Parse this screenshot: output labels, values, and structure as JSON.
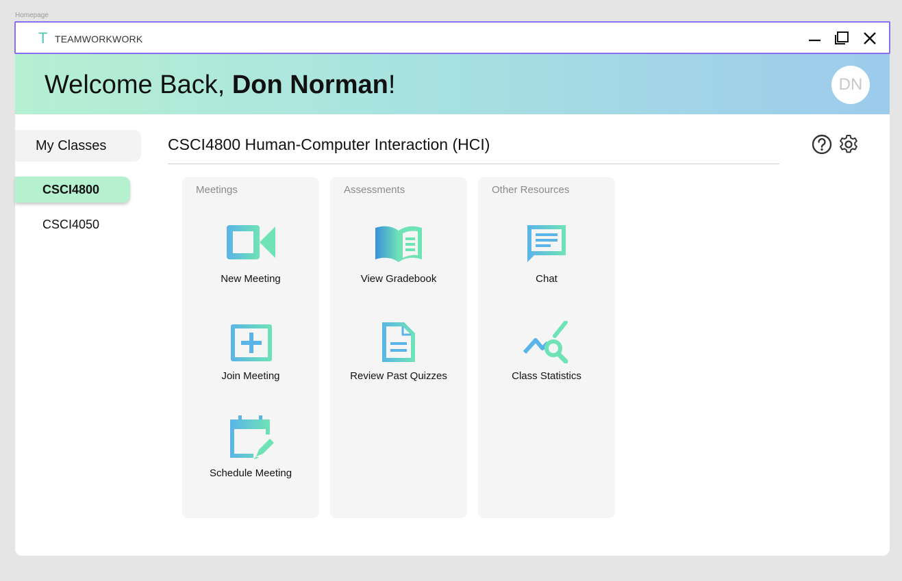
{
  "frame_label": "Homepage",
  "titlebar": {
    "logo_letter": "T",
    "app_name": "TEAMWORKWORK"
  },
  "header": {
    "welcome_prefix": "Welcome Back, ",
    "user_name": "Don Norman",
    "welcome_suffix": "!",
    "avatar_initials": "DN"
  },
  "sidebar": {
    "heading": "My Classes",
    "classes": [
      {
        "label": "CSCI4800",
        "active": true
      },
      {
        "label": "CSCI4050",
        "active": false
      }
    ]
  },
  "main": {
    "course_title": "CSCI4800 Human-Computer Interaction (HCI)",
    "panels": [
      {
        "title": "Meetings",
        "items": [
          {
            "label": "New Meeting",
            "icon": "video-camera-icon"
          },
          {
            "label": "Join Meeting",
            "icon": "plus-box-icon"
          },
          {
            "label": "Schedule Meeting",
            "icon": "calendar-edit-icon"
          }
        ]
      },
      {
        "title": "Assessments",
        "items": [
          {
            "label": "View Gradebook",
            "icon": "open-book-icon"
          },
          {
            "label": "Review Past Quizzes",
            "icon": "document-icon"
          }
        ]
      },
      {
        "title": "Other Resources",
        "items": [
          {
            "label": "Chat",
            "icon": "chat-bubble-icon"
          },
          {
            "label": "Class Statistics",
            "icon": "stats-search-icon"
          }
        ]
      }
    ]
  },
  "colors": {
    "accent_green": "#4fc9b0",
    "accent_blue": "#5ab4e8",
    "active_class_bg": "#b5f1cf",
    "titlebar_border": "#8c6cf0"
  }
}
